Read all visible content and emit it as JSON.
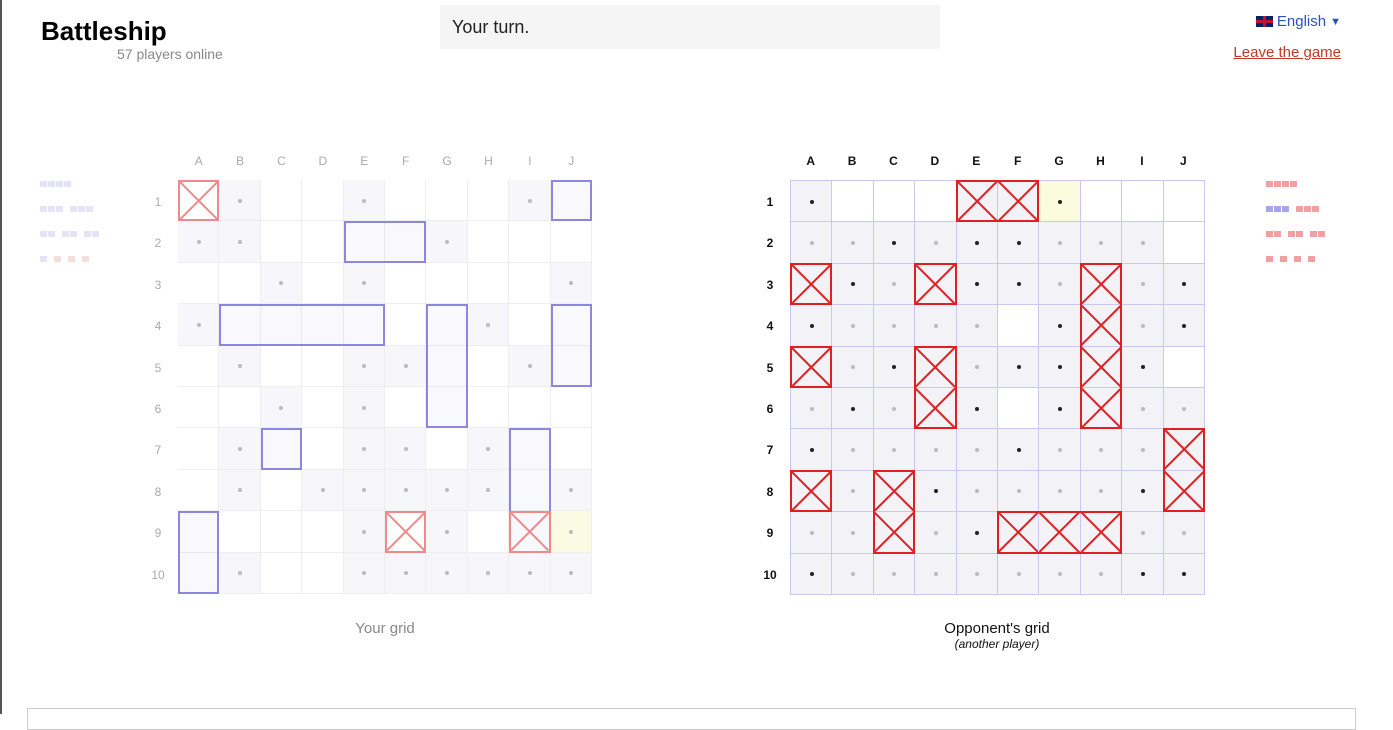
{
  "header": {
    "title": "Battleship",
    "players_online": "57 players online",
    "status": "Your turn.",
    "language": "English",
    "leave": "Leave the game"
  },
  "columns": [
    "A",
    "B",
    "C",
    "D",
    "E",
    "F",
    "G",
    "H",
    "I",
    "J"
  ],
  "rows": [
    "1",
    "2",
    "3",
    "4",
    "5",
    "6",
    "7",
    "8",
    "9",
    "10"
  ],
  "colors": {
    "own_ship": "#8c86e0",
    "hit_own": "#f08a8a",
    "opp_hit": "#e02020",
    "opp_border": "#c8c8f0"
  },
  "your_grid": {
    "caption": "Your grid",
    "ships": [
      {
        "r": 0,
        "c": 9,
        "len": 1,
        "dir": "h"
      },
      {
        "r": 1,
        "c": 4,
        "len": 2,
        "dir": "h"
      },
      {
        "r": 3,
        "c": 1,
        "len": 4,
        "dir": "h"
      },
      {
        "r": 3,
        "c": 6,
        "len": 3,
        "dir": "v"
      },
      {
        "r": 3,
        "c": 9,
        "len": 2,
        "dir": "v"
      },
      {
        "r": 6,
        "c": 2,
        "len": 1,
        "dir": "h"
      },
      {
        "r": 6,
        "c": 8,
        "len": 3,
        "dir": "v"
      },
      {
        "r": 8,
        "c": 0,
        "len": 2,
        "dir": "v"
      }
    ],
    "hits": [
      [
        0,
        0
      ],
      [
        8,
        5
      ],
      [
        8,
        8
      ]
    ],
    "misses": [
      [
        0,
        1
      ],
      [
        0,
        4
      ],
      [
        0,
        8
      ],
      [
        1,
        0
      ],
      [
        1,
        1
      ],
      [
        1,
        6
      ],
      [
        2,
        2
      ],
      [
        2,
        4
      ],
      [
        2,
        9
      ],
      [
        3,
        0
      ],
      [
        3,
        7
      ],
      [
        4,
        1
      ],
      [
        4,
        4
      ],
      [
        4,
        5
      ],
      [
        4,
        8
      ],
      [
        5,
        2
      ],
      [
        5,
        4
      ],
      [
        6,
        1
      ],
      [
        6,
        4
      ],
      [
        6,
        5
      ],
      [
        6,
        7
      ],
      [
        7,
        1
      ],
      [
        7,
        3
      ],
      [
        7,
        4
      ],
      [
        7,
        5
      ],
      [
        7,
        6
      ],
      [
        7,
        7
      ],
      [
        7,
        9
      ],
      [
        8,
        4
      ],
      [
        8,
        6
      ],
      [
        8,
        9
      ],
      [
        9,
        1
      ],
      [
        9,
        4
      ],
      [
        9,
        5
      ],
      [
        9,
        6
      ],
      [
        9,
        7
      ],
      [
        9,
        8
      ],
      [
        9,
        9
      ]
    ],
    "last_shot": [
      8,
      9
    ]
  },
  "opponent_grid": {
    "caption": "Opponent's grid",
    "subcaption": "(another player)",
    "hits": [
      [
        0,
        4
      ],
      [
        0,
        5
      ],
      [
        2,
        0
      ],
      [
        2,
        3
      ],
      [
        2,
        7
      ],
      [
        3,
        7
      ],
      [
        4,
        0
      ],
      [
        4,
        3
      ],
      [
        4,
        7
      ],
      [
        5,
        3
      ],
      [
        5,
        7
      ],
      [
        6,
        9
      ],
      [
        7,
        0
      ],
      [
        7,
        2
      ],
      [
        7,
        9
      ],
      [
        8,
        2
      ],
      [
        8,
        5
      ],
      [
        8,
        6
      ],
      [
        8,
        7
      ]
    ],
    "sunk_ships": [
      {
        "r": 0,
        "c": 4,
        "len": 2,
        "dir": "h"
      },
      {
        "r": 2,
        "c": 0,
        "len": 1,
        "dir": "h"
      },
      {
        "r": 2,
        "c": 3,
        "len": 1,
        "dir": "h"
      },
      {
        "r": 2,
        "c": 7,
        "len": 4,
        "dir": "v"
      },
      {
        "r": 4,
        "c": 0,
        "len": 1,
        "dir": "h"
      },
      {
        "r": 4,
        "c": 3,
        "len": 2,
        "dir": "v"
      },
      {
        "r": 6,
        "c": 9,
        "len": 2,
        "dir": "v"
      },
      {
        "r": 7,
        "c": 0,
        "len": 1,
        "dir": "h"
      },
      {
        "r": 7,
        "c": 2,
        "len": 2,
        "dir": "v"
      },
      {
        "r": 8,
        "c": 5,
        "len": 3,
        "dir": "h"
      }
    ],
    "shots_dark": [
      [
        0,
        0
      ],
      [
        0,
        6
      ],
      [
        1,
        2
      ],
      [
        1,
        4
      ],
      [
        1,
        5
      ],
      [
        2,
        1
      ],
      [
        2,
        4
      ],
      [
        2,
        5
      ],
      [
        2,
        9
      ],
      [
        3,
        0
      ],
      [
        3,
        6
      ],
      [
        3,
        9
      ],
      [
        4,
        2
      ],
      [
        4,
        5
      ],
      [
        4,
        6
      ],
      [
        4,
        8
      ],
      [
        5,
        1
      ],
      [
        5,
        4
      ],
      [
        5,
        6
      ],
      [
        6,
        0
      ],
      [
        6,
        5
      ],
      [
        7,
        3
      ],
      [
        7,
        8
      ],
      [
        8,
        4
      ],
      [
        9,
        0
      ],
      [
        9,
        8
      ],
      [
        9,
        9
      ]
    ],
    "shots_light": [
      [
        1,
        0
      ],
      [
        1,
        1
      ],
      [
        1,
        3
      ],
      [
        1,
        6
      ],
      [
        1,
        7
      ],
      [
        1,
        8
      ],
      [
        2,
        2
      ],
      [
        2,
        6
      ],
      [
        2,
        8
      ],
      [
        3,
        1
      ],
      [
        3,
        2
      ],
      [
        3,
        3
      ],
      [
        3,
        4
      ],
      [
        3,
        8
      ],
      [
        4,
        1
      ],
      [
        4,
        4
      ],
      [
        5,
        0
      ],
      [
        5,
        2
      ],
      [
        5,
        8
      ],
      [
        5,
        9
      ],
      [
        6,
        1
      ],
      [
        6,
        2
      ],
      [
        6,
        3
      ],
      [
        6,
        4
      ],
      [
        6,
        6
      ],
      [
        6,
        7
      ],
      [
        6,
        8
      ],
      [
        7,
        1
      ],
      [
        7,
        4
      ],
      [
        7,
        5
      ],
      [
        7,
        6
      ],
      [
        7,
        7
      ],
      [
        8,
        0
      ],
      [
        8,
        1
      ],
      [
        8,
        3
      ],
      [
        8,
        8
      ],
      [
        8,
        9
      ],
      [
        9,
        1
      ],
      [
        9,
        2
      ],
      [
        9,
        3
      ],
      [
        9,
        4
      ],
      [
        9,
        5
      ],
      [
        9,
        6
      ],
      [
        9,
        7
      ]
    ],
    "revealed_empty": [
      [
        0,
        1
      ],
      [
        0,
        2
      ],
      [
        0,
        3
      ],
      [
        0,
        7
      ],
      [
        0,
        8
      ],
      [
        0,
        9
      ],
      [
        1,
        9
      ],
      [
        3,
        5
      ],
      [
        4,
        9
      ],
      [
        5,
        5
      ]
    ],
    "last_shot": [
      0,
      6
    ]
  },
  "fleet_left": {
    "rows": [
      [
        {
          "n": 4,
          "sunk": false
        }
      ],
      [
        {
          "n": 3,
          "sunk": false
        },
        {
          "n": 3,
          "sunk": false
        }
      ],
      [
        {
          "n": 2,
          "sunk": false
        },
        {
          "n": 2,
          "sunk": false
        },
        {
          "n": 2,
          "sunk": false
        }
      ],
      [
        {
          "n": 1,
          "sunk": false
        },
        {
          "n": 1,
          "sunk": true
        },
        {
          "n": 1,
          "sunk": true
        },
        {
          "n": 1,
          "sunk": true
        }
      ]
    ]
  },
  "fleet_right": {
    "rows": [
      [
        {
          "n": 4,
          "sunk": true
        }
      ],
      [
        {
          "n": 3,
          "sunk": false
        },
        {
          "n": 3,
          "sunk": true
        }
      ],
      [
        {
          "n": 2,
          "sunk": true
        },
        {
          "n": 2,
          "sunk": true
        },
        {
          "n": 2,
          "sunk": true
        }
      ],
      [
        {
          "n": 1,
          "sunk": true
        },
        {
          "n": 1,
          "sunk": true
        },
        {
          "n": 1,
          "sunk": true
        },
        {
          "n": 1,
          "sunk": true
        }
      ]
    ]
  }
}
